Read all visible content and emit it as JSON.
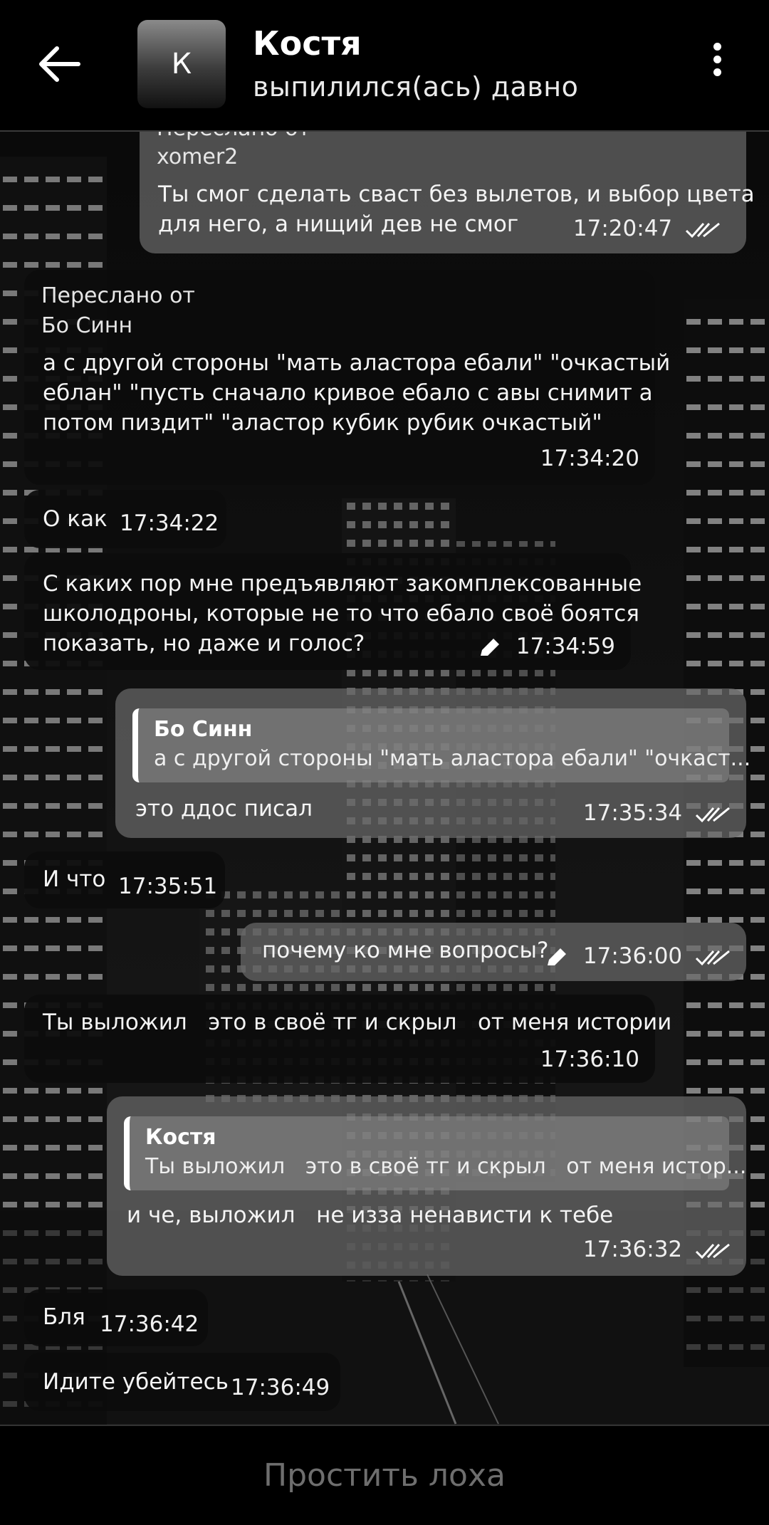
{
  "header": {
    "avatar_letter": "К",
    "name": "Костя",
    "status": "выпилился(ась) давно"
  },
  "messages": [
    {
      "direction": "out",
      "forward_label": "Переслано от",
      "forward_from": "xomer2",
      "text_lines": [
        "Ты смог сделать сваст без вылетов, и выбор цвета",
        "для него, а нищий дев не смог"
      ],
      "time": "17:20:47",
      "read": true
    },
    {
      "direction": "in",
      "forward_label": "Переслано от",
      "forward_from": "Бо Синн",
      "text_lines": [
        "а с другой стороны \"мать аластора ебали\" \"очкастый",
        "еблан\" \"пусть сначало кривое ебало с авы снимит а",
        "потом пиздит\" \"аластор кубик рубик очкастый\""
      ],
      "time": "17:34:20"
    },
    {
      "direction": "in",
      "text": "О как",
      "time": "17:34:22"
    },
    {
      "direction": "in",
      "text_lines": [
        "С каких пор мне предъявляют закомплексованные",
        "школодроны, которые не то что ебало своё боятся",
        "показать, но даже и голос?"
      ],
      "edited": true,
      "time": "17:34:59"
    },
    {
      "direction": "out",
      "reply_name": "Бо Синн",
      "reply_text": "а с другой стороны \"мать аластора ебали\" \"очкаст...",
      "text": "это ддос писал",
      "time": "17:35:34",
      "read": true
    },
    {
      "direction": "in",
      "text": "И что",
      "time": "17:35:51"
    },
    {
      "direction": "out",
      "text": "почему ко мне вопросы?",
      "edited": true,
      "time": "17:36:00",
      "read": true
    },
    {
      "direction": "in",
      "text": "Ты выложил   это в своё тг и скрыл   от меня истории",
      "time": "17:36:10"
    },
    {
      "direction": "out",
      "reply_name": "Костя",
      "reply_text": "Ты выложил   это в своё тг и скрыл   от меня истор...",
      "text": "и че, выложил   не изза ненависти к тебе",
      "time": "17:36:32",
      "read": true
    },
    {
      "direction": "in",
      "text": "Бля",
      "time": "17:36:42"
    },
    {
      "direction": "in",
      "text": "Идите убейтесь",
      "time": "17:36:49"
    }
  ],
  "bottom_bar": {
    "label": "Простить лоха"
  }
}
